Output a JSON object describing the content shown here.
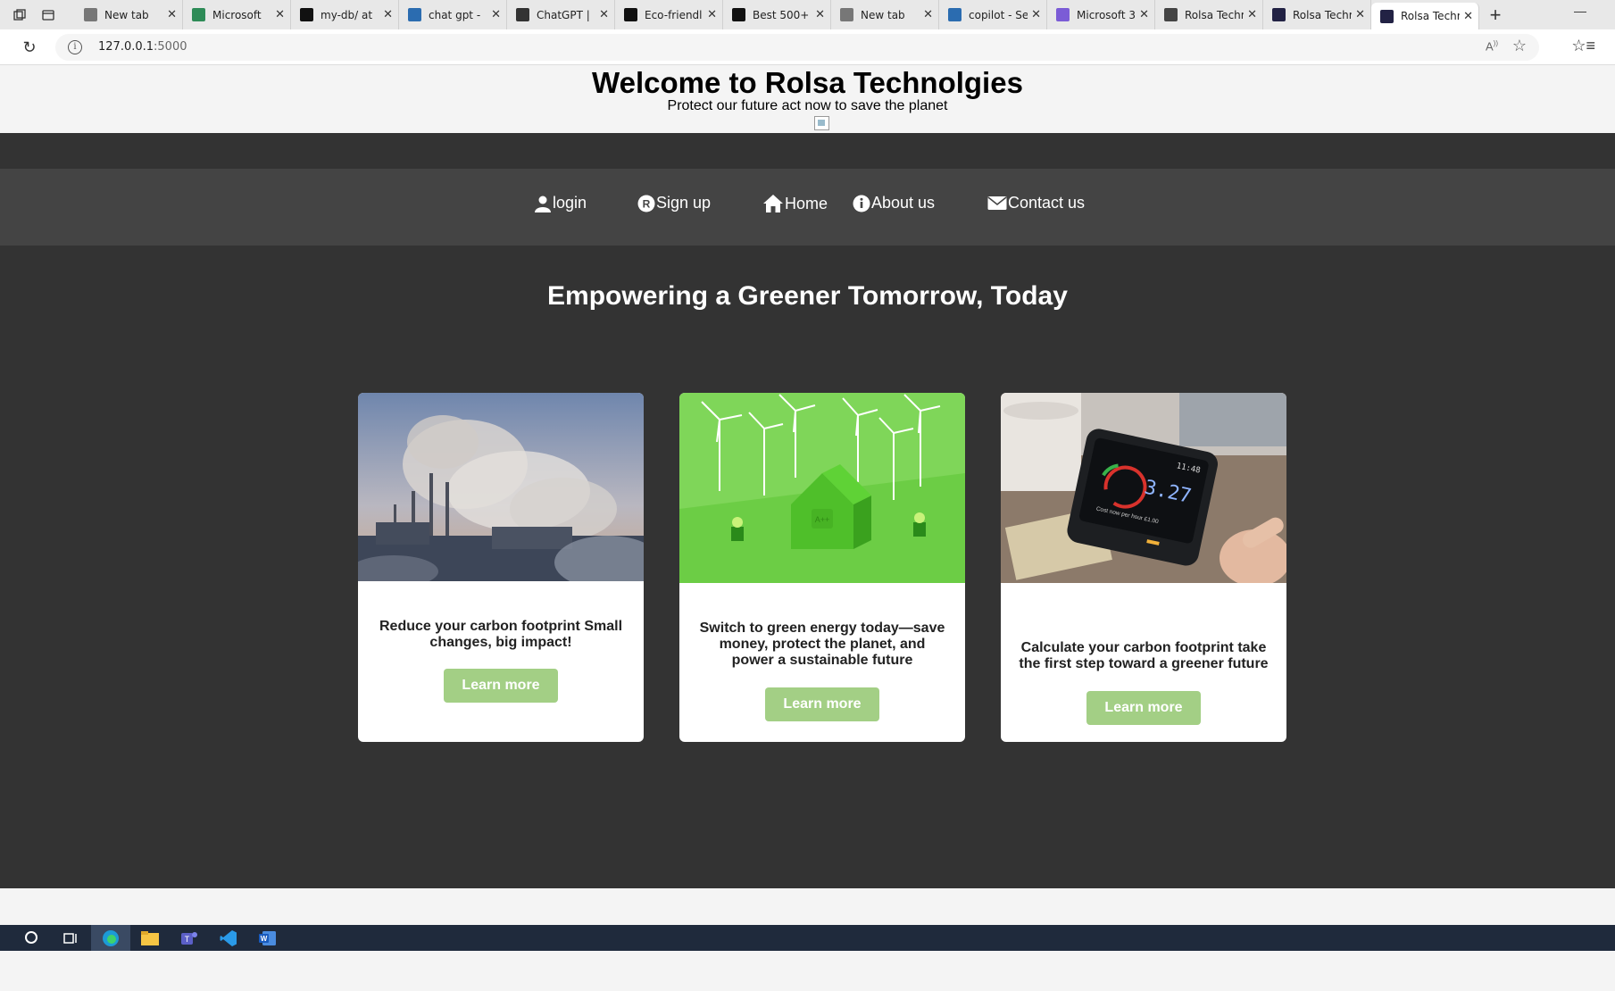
{
  "browser": {
    "tabs": [
      {
        "label": "New tab",
        "favicon": "newtab-icon",
        "color": "#777777"
      },
      {
        "label": "Microsoft",
        "favicon": "microsoft-forms-icon",
        "color": "#2e8b57"
      },
      {
        "label": "my-db/ at",
        "favicon": "github-icon",
        "color": "#111111"
      },
      {
        "label": "chat gpt -",
        "favicon": "search-icon",
        "color": "#2b6cb0"
      },
      {
        "label": "ChatGPT |",
        "favicon": "chatgpt-icon",
        "color": "#333333"
      },
      {
        "label": "Eco-friendl",
        "favicon": "chatgpt-icon",
        "color": "#111111"
      },
      {
        "label": "Best 500+",
        "favicon": "unsplash-icon",
        "color": "#111111"
      },
      {
        "label": "New tab",
        "favicon": "newtab-icon",
        "color": "#777777"
      },
      {
        "label": "copilot - Se",
        "favicon": "search-icon",
        "color": "#2b6cb0"
      },
      {
        "label": "Microsoft 3",
        "favicon": "copilot-icon",
        "color": "#7b5cd6"
      },
      {
        "label": "Rolsa Techr",
        "favicon": "globe-icon",
        "color": "#444444"
      },
      {
        "label": "Rolsa Techr",
        "favicon": "terminal-icon",
        "color": "#222244"
      },
      {
        "label": "Rolsa Techr",
        "favicon": "terminal-icon",
        "color": "#222244"
      }
    ],
    "active_tab": 12,
    "url_host": "127.0.0.1",
    "url_port": ":5000"
  },
  "site": {
    "title": "Welcome to Rolsa Technolgies",
    "tagline": "Protect our future act now to save the planet"
  },
  "nav": {
    "login": "login",
    "signup": "Sign up",
    "home": "Home",
    "about": "About us",
    "contact": "Contact us"
  },
  "hero": {
    "title": "Empowering a Greener Tomorrow, Today"
  },
  "cards": [
    {
      "text": "Reduce your carbon footprint Small changes, big impact!",
      "button": "Learn more",
      "image": "factory-smoke-image"
    },
    {
      "text": "Switch to green energy today—save money, protect the planet, and power a sustainable future",
      "button": "Learn more",
      "image": "green-house-wind-turbines-image"
    },
    {
      "text": "Calculate your carbon footprint take the first step toward a greener future",
      "button": "Learn more",
      "image": "smart-energy-meter-image",
      "meter_reading": "3.27",
      "meter_time": "11:48",
      "meter_cost": "Cost now per hour £1.00"
    }
  ],
  "colors": {
    "accent_button": "#a3cf85",
    "dark_band": "#333333",
    "navbar": "#444444"
  }
}
